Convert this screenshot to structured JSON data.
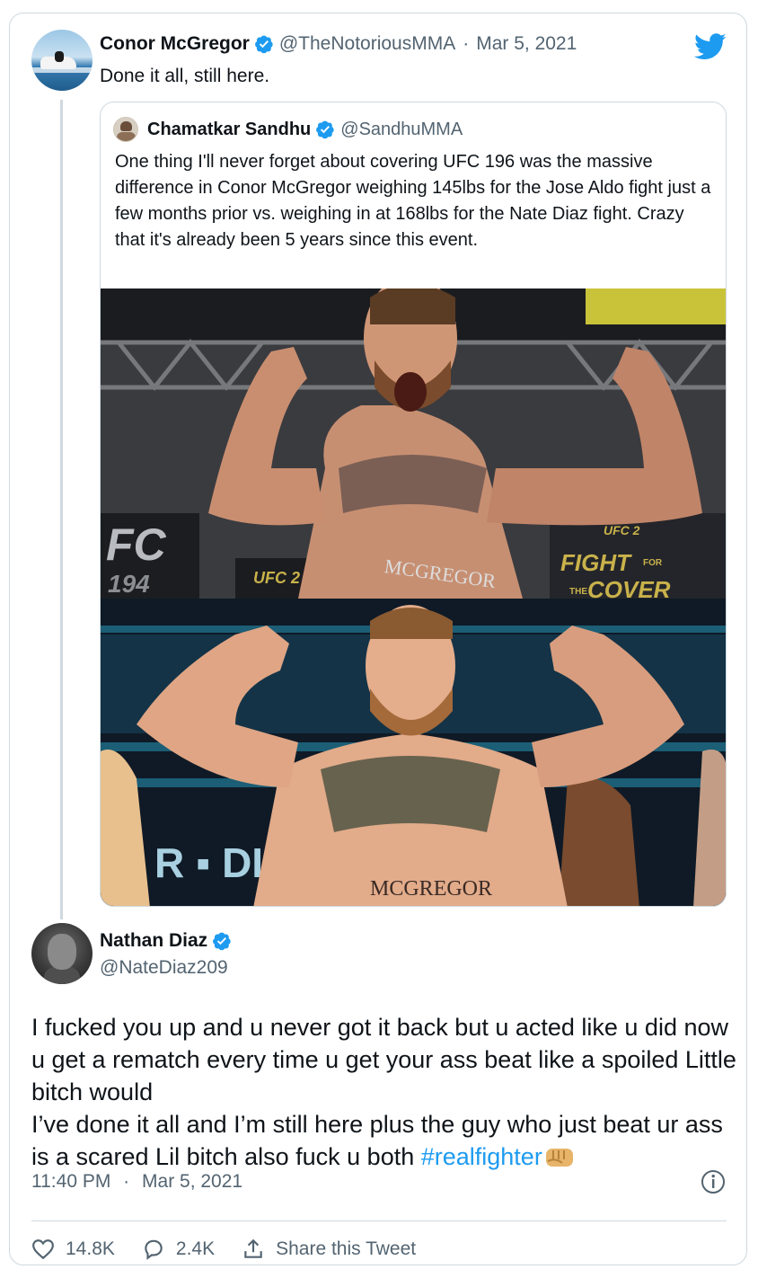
{
  "parent": {
    "name": "Conor McGregor",
    "handle": "@TheNotoriousMMA",
    "separator": "·",
    "date": "Mar 5, 2021",
    "text": "Done it all, still here."
  },
  "quote": {
    "name": "Chamatkar Sandhu",
    "handle": "@SandhuMMA",
    "text": "One thing I'll never forget about covering UFC 196 was the massive difference in Conor McGregor weighing 145lbs for the Jose Aldo fight just a few months prior vs. weighing in at 168lbs for the Nate Diaz fight. Crazy that it's already been 5 years since this event.",
    "photo1": {
      "banner_left": "FC",
      "banner_left_sub": "194",
      "badge": "UFC 2",
      "trunks": "MCGREGOR",
      "right_sign_top": "UFC 2",
      "right_sign_line1": "FIGHT",
      "right_sign_word": "FOR",
      "right_sign_line2": "COVER",
      "right_sign_word2": "THE"
    },
    "photo2": {
      "screen_text": "R ▪ DIA",
      "trunks": "MCGREGOR"
    }
  },
  "reply": {
    "name": "Nathan Diaz",
    "handle": "@NateDiaz209",
    "line1": "I fucked you up and u never got it back but u acted like u did now u get a rematch every time u get your ass beat like a spoiled Little bitch would",
    "line2": "I’ve done it all and I’m still here plus the guy who just beat ur ass is a scared  Lil bitch also fuck u both ",
    "hashtag": "#realfighter",
    "time": "11:40 PM",
    "separator": "·",
    "date": "Mar 5, 2021"
  },
  "actions": {
    "likes": "14.8K",
    "replies": "2.4K",
    "share": "Share this Tweet"
  },
  "colors": {
    "accent": "#1d9bf0",
    "secondary_text": "#536471",
    "border": "#cfd9de"
  }
}
